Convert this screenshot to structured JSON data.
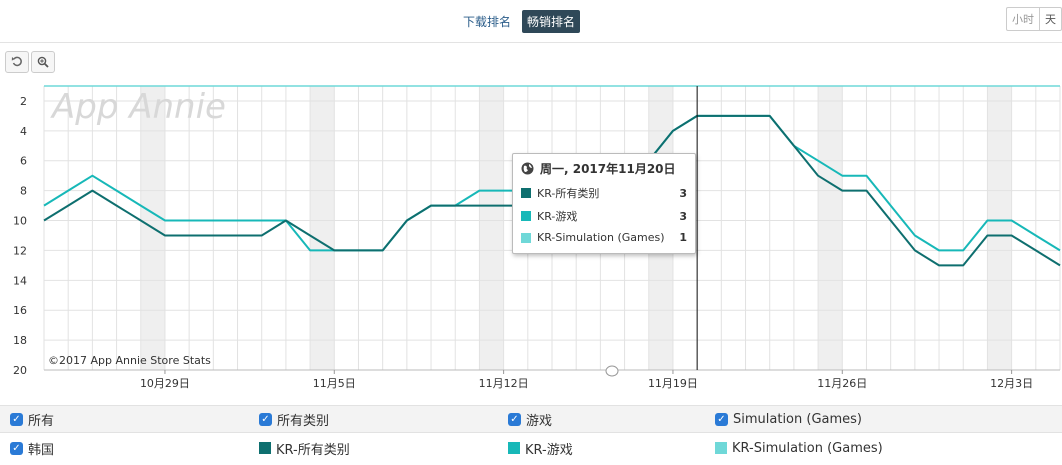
{
  "tabs": {
    "download": "下载排名",
    "grossing": "畅销排名"
  },
  "granularity": {
    "hour": "小时",
    "day": "天"
  },
  "watermark": "App Annie",
  "copyright": "©2017 App Annie Store Stats",
  "tooltip": {
    "date": "周一, 2017年11月20日",
    "rows": [
      {
        "name": "KR-所有类别",
        "value": "3",
        "color": "#0e6f6f"
      },
      {
        "name": "KR-游戏",
        "value": "3",
        "color": "#17b8b8"
      },
      {
        "name": "KR-Simulation (Games)",
        "value": "1",
        "color": "#6fd8d8"
      }
    ]
  },
  "legend": {
    "filter_all": "所有",
    "filter_all_cat": "所有类别",
    "filter_games": "游戏",
    "filter_sim": "Simulation (Games)",
    "country": "韩国",
    "s1": "KR-所有类别",
    "s2": "KR-游戏",
    "s3": "KR-Simulation (Games)"
  },
  "chart_data": {
    "type": "line",
    "x": [
      "2017-10-24",
      "2017-10-25",
      "2017-10-26",
      "2017-10-27",
      "2017-10-28",
      "2017-10-29",
      "2017-10-30",
      "2017-10-31",
      "2017-11-01",
      "2017-11-02",
      "2017-11-03",
      "2017-11-04",
      "2017-11-05",
      "2017-11-06",
      "2017-11-07",
      "2017-11-08",
      "2017-11-09",
      "2017-11-10",
      "2017-11-11",
      "2017-11-12",
      "2017-11-13",
      "2017-11-14",
      "2017-11-15",
      "2017-11-16",
      "2017-11-17",
      "2017-11-18",
      "2017-11-19",
      "2017-11-20",
      "2017-11-21",
      "2017-11-22",
      "2017-11-23",
      "2017-11-24",
      "2017-11-25",
      "2017-11-26",
      "2017-11-27",
      "2017-11-28",
      "2017-11-29",
      "2017-11-30",
      "2017-12-01",
      "2017-12-02",
      "2017-12-03",
      "2017-12-04",
      "2017-12-05"
    ],
    "x_tick_labels": [
      {
        "date": "2017-10-29",
        "label": "10月29日"
      },
      {
        "date": "2017-11-05",
        "label": "11月5日"
      },
      {
        "date": "2017-11-12",
        "label": "11月12日"
      },
      {
        "date": "2017-11-19",
        "label": "11月19日"
      },
      {
        "date": "2017-11-26",
        "label": "11月26日"
      },
      {
        "date": "2017-12-03",
        "label": "12月3日"
      }
    ],
    "series": [
      {
        "name": "KR-所有类别",
        "color": "#0e6f6f",
        "values": [
          10,
          9,
          8,
          9,
          10,
          11,
          11,
          11,
          11,
          11,
          10,
          11,
          12,
          12,
          12,
          10,
          9,
          9,
          9,
          9,
          9,
          9,
          9,
          9,
          8,
          6,
          4,
          3,
          3,
          3,
          3,
          5,
          7,
          8,
          8,
          10,
          12,
          13,
          13,
          11,
          11,
          12,
          13
        ]
      },
      {
        "name": "KR-游戏",
        "color": "#17b8b8",
        "values": [
          9,
          8,
          7,
          8,
          9,
          10,
          10,
          10,
          10,
          10,
          10,
          12,
          12,
          12,
          12,
          10,
          9,
          9,
          8,
          8,
          8,
          8,
          8,
          8,
          7,
          6,
          4,
          3,
          3,
          3,
          3,
          5,
          6,
          7,
          7,
          9,
          11,
          12,
          12,
          10,
          10,
          11,
          12
        ]
      },
      {
        "name": "KR-Simulation (Games)",
        "color": "#6fd8d8",
        "values": [
          1,
          1,
          1,
          1,
          1,
          1,
          1,
          1,
          1,
          1,
          1,
          1,
          1,
          1,
          1,
          1,
          1,
          1,
          1,
          1,
          1,
          1,
          1,
          1,
          1,
          1,
          1,
          1,
          1,
          1,
          1,
          1,
          1,
          1,
          1,
          1,
          1,
          1,
          1,
          1,
          1,
          1,
          1
        ]
      }
    ],
    "y_ticks": [
      2,
      4,
      6,
      8,
      10,
      12,
      14,
      16,
      18,
      20
    ],
    "ylim": [
      1,
      20
    ],
    "y_reversed": true,
    "crosshair_date": "2017-11-20",
    "weekend_shading": true,
    "grid": true
  }
}
